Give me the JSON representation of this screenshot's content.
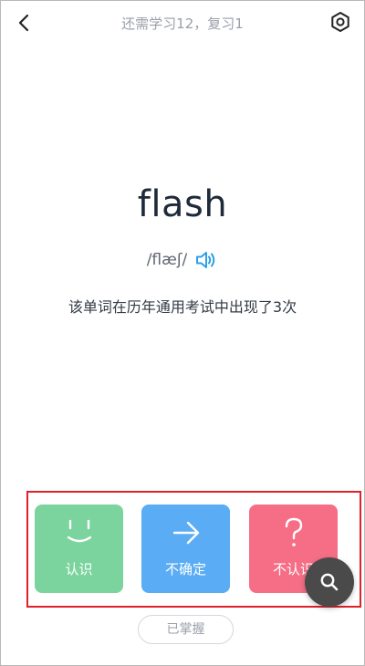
{
  "header": {
    "title": "还需学习12，复习1",
    "back_icon": "chevron-left-icon",
    "settings_icon": "settings-icon"
  },
  "card": {
    "word": "flash",
    "phonetic": "/flæʃ/",
    "speaker_icon": "speaker-icon",
    "frequency_text": "该单词在历年通用考试中出现了3次"
  },
  "choices": [
    {
      "label": "认识",
      "icon": "smile-face-icon",
      "color": "#7bd49d"
    },
    {
      "label": "不确定",
      "icon": "arrow-right-icon",
      "color": "#5aacf5"
    },
    {
      "label": "不认识",
      "icon": "question-mark-icon",
      "color": "#f56e86"
    }
  ],
  "search_icon": "search-icon",
  "mastered_label": "已掌握",
  "colors": {
    "highlight_border": "#e0202a",
    "accent_speaker": "#2aa0e6"
  }
}
